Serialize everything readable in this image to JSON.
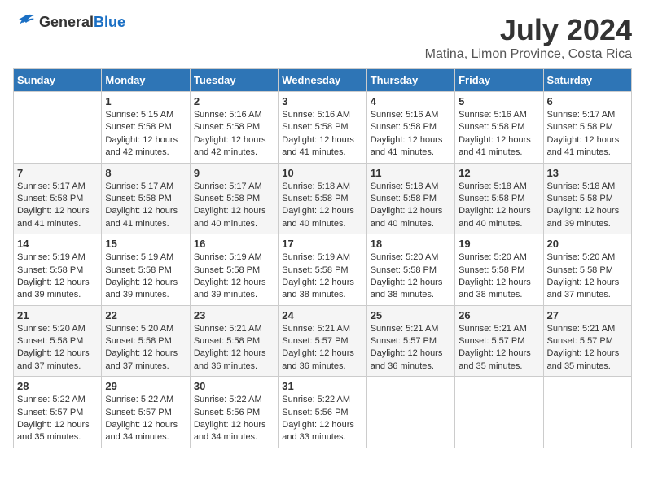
{
  "header": {
    "logo_general": "General",
    "logo_blue": "Blue",
    "main_title": "July 2024",
    "subtitle": "Matina, Limon Province, Costa Rica"
  },
  "calendar": {
    "days_of_week": [
      "Sunday",
      "Monday",
      "Tuesday",
      "Wednesday",
      "Thursday",
      "Friday",
      "Saturday"
    ],
    "weeks": [
      [
        {
          "day": "",
          "info": ""
        },
        {
          "day": "1",
          "info": "Sunrise: 5:15 AM\nSunset: 5:58 PM\nDaylight: 12 hours\nand 42 minutes."
        },
        {
          "day": "2",
          "info": "Sunrise: 5:16 AM\nSunset: 5:58 PM\nDaylight: 12 hours\nand 42 minutes."
        },
        {
          "day": "3",
          "info": "Sunrise: 5:16 AM\nSunset: 5:58 PM\nDaylight: 12 hours\nand 41 minutes."
        },
        {
          "day": "4",
          "info": "Sunrise: 5:16 AM\nSunset: 5:58 PM\nDaylight: 12 hours\nand 41 minutes."
        },
        {
          "day": "5",
          "info": "Sunrise: 5:16 AM\nSunset: 5:58 PM\nDaylight: 12 hours\nand 41 minutes."
        },
        {
          "day": "6",
          "info": "Sunrise: 5:17 AM\nSunset: 5:58 PM\nDaylight: 12 hours\nand 41 minutes."
        }
      ],
      [
        {
          "day": "7",
          "info": "Sunrise: 5:17 AM\nSunset: 5:58 PM\nDaylight: 12 hours\nand 41 minutes."
        },
        {
          "day": "8",
          "info": "Sunrise: 5:17 AM\nSunset: 5:58 PM\nDaylight: 12 hours\nand 41 minutes."
        },
        {
          "day": "9",
          "info": "Sunrise: 5:17 AM\nSunset: 5:58 PM\nDaylight: 12 hours\nand 40 minutes."
        },
        {
          "day": "10",
          "info": "Sunrise: 5:18 AM\nSunset: 5:58 PM\nDaylight: 12 hours\nand 40 minutes."
        },
        {
          "day": "11",
          "info": "Sunrise: 5:18 AM\nSunset: 5:58 PM\nDaylight: 12 hours\nand 40 minutes."
        },
        {
          "day": "12",
          "info": "Sunrise: 5:18 AM\nSunset: 5:58 PM\nDaylight: 12 hours\nand 40 minutes."
        },
        {
          "day": "13",
          "info": "Sunrise: 5:18 AM\nSunset: 5:58 PM\nDaylight: 12 hours\nand 39 minutes."
        }
      ],
      [
        {
          "day": "14",
          "info": "Sunrise: 5:19 AM\nSunset: 5:58 PM\nDaylight: 12 hours\nand 39 minutes."
        },
        {
          "day": "15",
          "info": "Sunrise: 5:19 AM\nSunset: 5:58 PM\nDaylight: 12 hours\nand 39 minutes."
        },
        {
          "day": "16",
          "info": "Sunrise: 5:19 AM\nSunset: 5:58 PM\nDaylight: 12 hours\nand 39 minutes."
        },
        {
          "day": "17",
          "info": "Sunrise: 5:19 AM\nSunset: 5:58 PM\nDaylight: 12 hours\nand 38 minutes."
        },
        {
          "day": "18",
          "info": "Sunrise: 5:20 AM\nSunset: 5:58 PM\nDaylight: 12 hours\nand 38 minutes."
        },
        {
          "day": "19",
          "info": "Sunrise: 5:20 AM\nSunset: 5:58 PM\nDaylight: 12 hours\nand 38 minutes."
        },
        {
          "day": "20",
          "info": "Sunrise: 5:20 AM\nSunset: 5:58 PM\nDaylight: 12 hours\nand 37 minutes."
        }
      ],
      [
        {
          "day": "21",
          "info": "Sunrise: 5:20 AM\nSunset: 5:58 PM\nDaylight: 12 hours\nand 37 minutes."
        },
        {
          "day": "22",
          "info": "Sunrise: 5:20 AM\nSunset: 5:58 PM\nDaylight: 12 hours\nand 37 minutes."
        },
        {
          "day": "23",
          "info": "Sunrise: 5:21 AM\nSunset: 5:58 PM\nDaylight: 12 hours\nand 36 minutes."
        },
        {
          "day": "24",
          "info": "Sunrise: 5:21 AM\nSunset: 5:57 PM\nDaylight: 12 hours\nand 36 minutes."
        },
        {
          "day": "25",
          "info": "Sunrise: 5:21 AM\nSunset: 5:57 PM\nDaylight: 12 hours\nand 36 minutes."
        },
        {
          "day": "26",
          "info": "Sunrise: 5:21 AM\nSunset: 5:57 PM\nDaylight: 12 hours\nand 35 minutes."
        },
        {
          "day": "27",
          "info": "Sunrise: 5:21 AM\nSunset: 5:57 PM\nDaylight: 12 hours\nand 35 minutes."
        }
      ],
      [
        {
          "day": "28",
          "info": "Sunrise: 5:22 AM\nSunset: 5:57 PM\nDaylight: 12 hours\nand 35 minutes."
        },
        {
          "day": "29",
          "info": "Sunrise: 5:22 AM\nSunset: 5:57 PM\nDaylight: 12 hours\nand 34 minutes."
        },
        {
          "day": "30",
          "info": "Sunrise: 5:22 AM\nSunset: 5:56 PM\nDaylight: 12 hours\nand 34 minutes."
        },
        {
          "day": "31",
          "info": "Sunrise: 5:22 AM\nSunset: 5:56 PM\nDaylight: 12 hours\nand 33 minutes."
        },
        {
          "day": "",
          "info": ""
        },
        {
          "day": "",
          "info": ""
        },
        {
          "day": "",
          "info": ""
        }
      ]
    ]
  }
}
